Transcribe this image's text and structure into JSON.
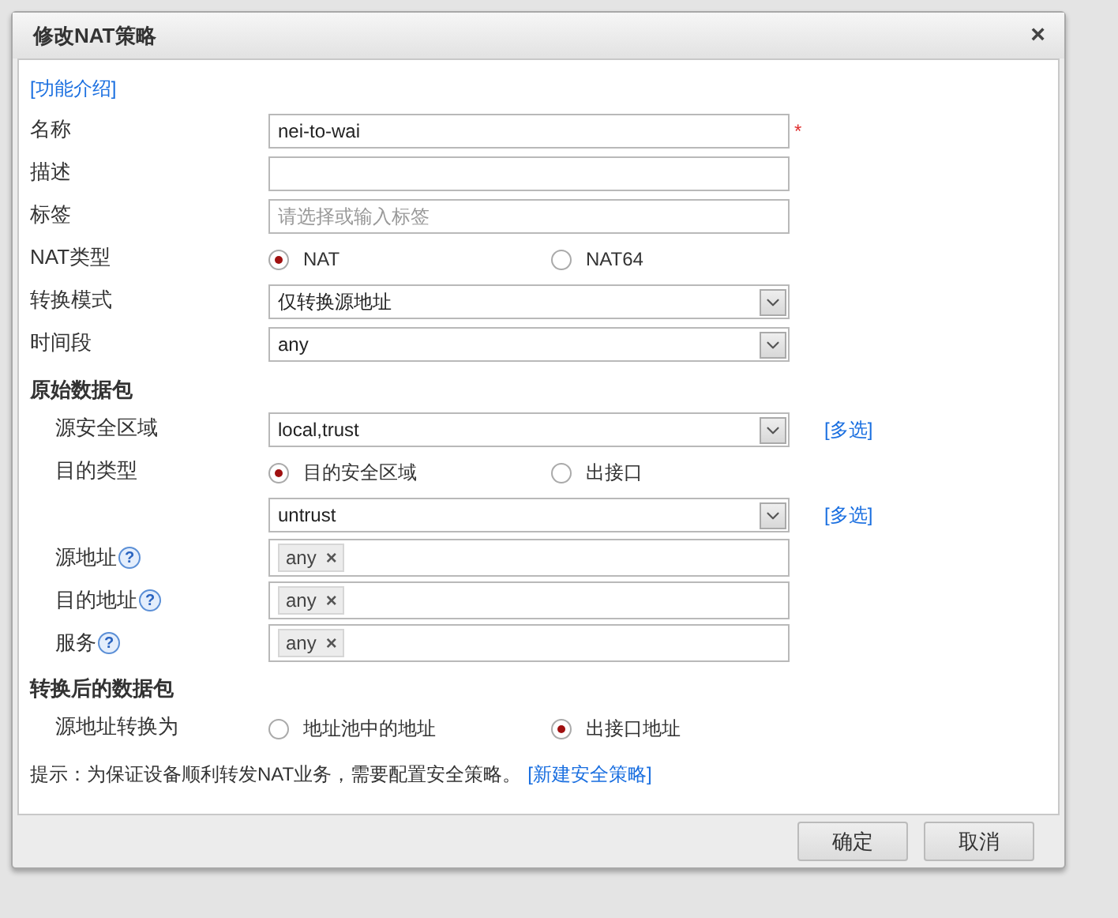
{
  "dialog": {
    "title": "修改NAT策略",
    "close": "×"
  },
  "intro_link": "[功能介绍]",
  "rows": [
    {
      "kind": "text",
      "label": "名称",
      "value": "nei-to-wai",
      "required_mark": "*"
    },
    {
      "kind": "text",
      "label": "描述"
    },
    {
      "kind": "text",
      "label": "标签",
      "placeholder": "请选择或输入标签"
    },
    {
      "kind": "radio",
      "label": "NAT类型",
      "options": [
        {
          "label": "NAT",
          "selected": true
        },
        {
          "label": "NAT64",
          "selected": false
        }
      ]
    },
    {
      "kind": "select",
      "label": "转换模式",
      "value": "仅转换源地址"
    },
    {
      "kind": "select",
      "label": "时间段",
      "value": "any"
    },
    {
      "kind": "section",
      "label": "原始数据包",
      "children": [
        {
          "kind": "select",
          "label": "源安全区域",
          "value": "local,trust",
          "link": "[多选]"
        },
        {
          "kind": "radio",
          "label": "目的类型",
          "options": [
            {
              "label": "目的安全区域",
              "selected": true
            },
            {
              "label": "出接口",
              "selected": false
            }
          ]
        },
        {
          "kind": "select",
          "value": "untrust",
          "link": "[多选]"
        },
        {
          "kind": "tags",
          "label": "源地址",
          "help": "?",
          "tags": [
            {
              "label": "any",
              "remove": "×"
            }
          ]
        },
        {
          "kind": "tags",
          "label": "目的地址",
          "help": "?",
          "tags": [
            {
              "label": "any",
              "remove": "×"
            }
          ]
        },
        {
          "kind": "tags",
          "label": "服务",
          "help": "?",
          "tags": [
            {
              "label": "any",
              "remove": "×"
            }
          ]
        }
      ]
    },
    {
      "kind": "section",
      "label": "转换后的数据包",
      "children": [
        {
          "kind": "radio",
          "label": "源地址转换为",
          "options": [
            {
              "label": "地址池中的地址",
              "selected": false
            },
            {
              "label": "出接口地址",
              "selected": true
            }
          ]
        }
      ]
    },
    {
      "kind": "note",
      "text": "提示：为保证设备顺利转发NAT业务，需要配置安全策略。",
      "link": "[新建安全策略]"
    }
  ],
  "buttons": [
    "确定",
    "取消"
  ]
}
